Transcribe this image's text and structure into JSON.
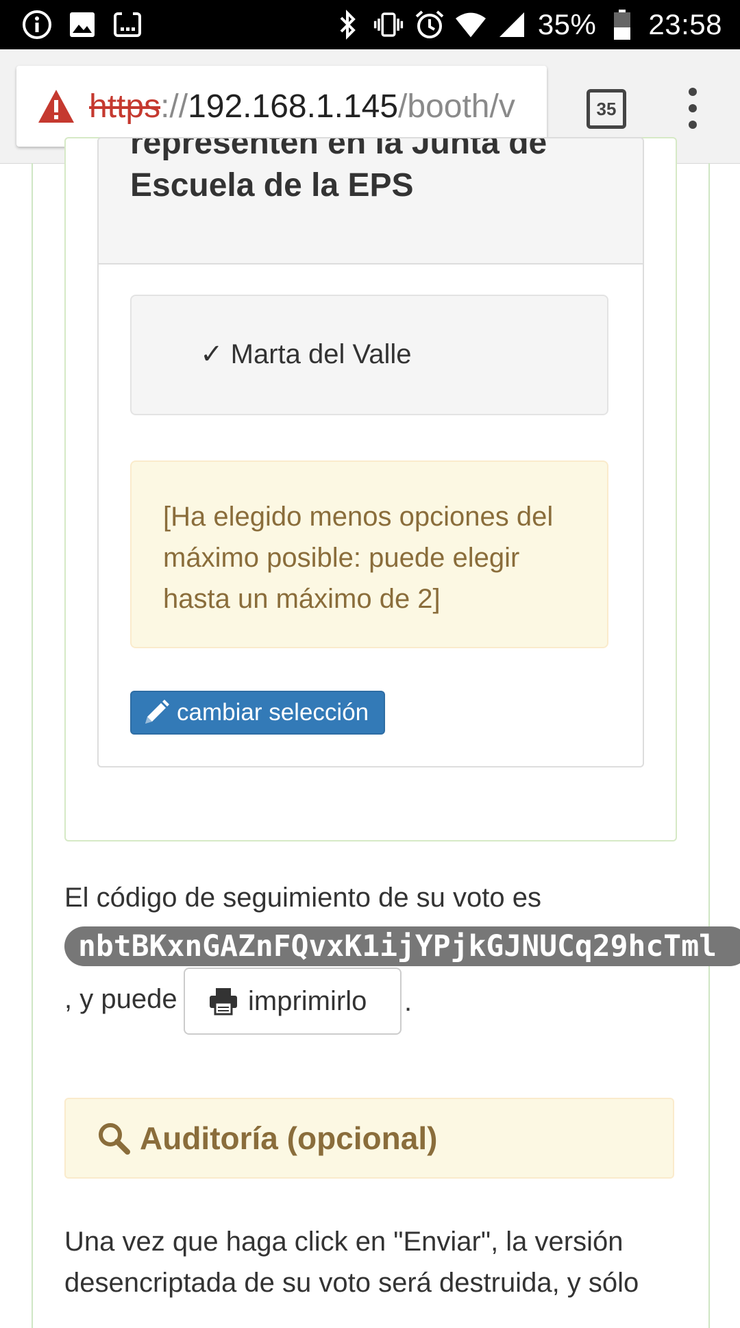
{
  "status_bar": {
    "battery_percent": "35%",
    "time": "23:58",
    "left_icons": [
      "info-icon",
      "image-icon",
      "screenshot-icon"
    ],
    "right_icons": [
      "bluetooth-icon",
      "vibrate-icon",
      "alarm-icon",
      "wifi-icon",
      "signal-icon",
      "battery-icon"
    ]
  },
  "browser": {
    "url_scheme": "https",
    "url_sep": "://",
    "url_host": "192.168.1.145",
    "url_path": "/booth/v",
    "tab_count": "35",
    "warning_color": "#c5392f"
  },
  "question": {
    "title": "representen en la Junta de Escuela de la EPS"
  },
  "choice": {
    "check": "✓",
    "label": "Marta del Valle"
  },
  "warning": {
    "text": "[Ha elegido menos opciones del máximo posible: puede elegir hasta un máximo de 2]"
  },
  "buttons": {
    "change_selection": "cambiar selección",
    "print": "imprimirlo"
  },
  "tracking": {
    "intro": "El código de seguimiento de su voto es",
    "code": "nbtBKxnGAZnFQvxK1ijYPjkGJNUCq29hcTml",
    "puede": ", y puede",
    "period": "."
  },
  "audit": {
    "title": "Auditoría (opcional)"
  },
  "footer_text": "Una vez que haga click en \"Enviar\", la versión desencriptada de su voto será destruida, y sólo",
  "colors": {
    "primary": "#337ab7",
    "warning_bg": "#fcf8e3",
    "warning_text": "#8a6d3b",
    "success_border": "#d6e9c6",
    "code_bg": "#777777"
  }
}
